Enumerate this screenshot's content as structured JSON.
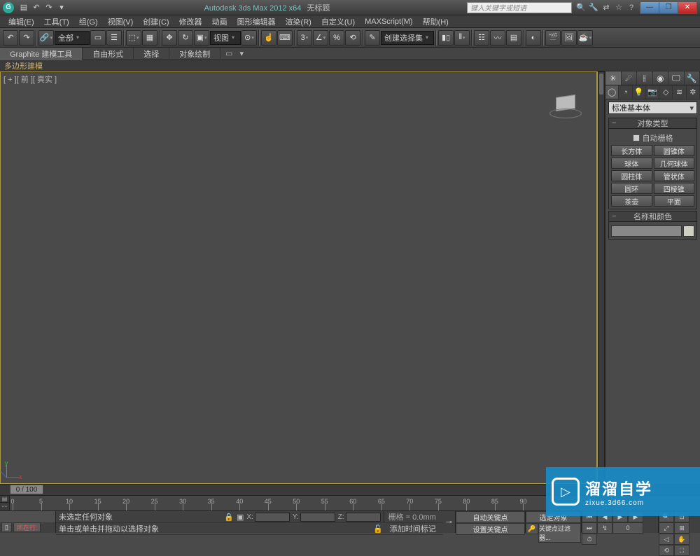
{
  "titlebar": {
    "app": "Autodesk 3ds Max  2012 x64",
    "doc": "无标题",
    "search_placeholder": "键入关键字或短语"
  },
  "menu": [
    "编辑(E)",
    "工具(T)",
    "组(G)",
    "视图(V)",
    "创建(C)",
    "修改器",
    "动画",
    "图形编辑器",
    "渲染(R)",
    "自定义(U)",
    "MAXScript(M)",
    "帮助(H)"
  ],
  "toolbar": {
    "filter": "全部",
    "viewdrop": "视图",
    "selset": "创建选择集"
  },
  "ribbon": {
    "tab": "Graphite 建模工具",
    "tabs_other": [
      "自由形式",
      "选择",
      "对象绘制"
    ],
    "panel": "多边形建模"
  },
  "viewport": {
    "label": "[ + ][ 前 ][ 真实 ]"
  },
  "cmdpanel": {
    "category": "标准基本体",
    "rollout_objtype": "对象类型",
    "autogrid": "自动栅格",
    "prims": [
      [
        "长方体",
        "圆锥体"
      ],
      [
        "球体",
        "几何球体"
      ],
      [
        "圆柱体",
        "管状体"
      ],
      [
        "圆环",
        "四棱锥"
      ],
      [
        "茶壶",
        "平面"
      ]
    ],
    "rollout_name": "名称和颜色"
  },
  "timeline": {
    "slider": "0 / 100",
    "ticks": [
      0,
      5,
      10,
      15,
      20,
      25,
      30,
      35,
      40,
      45,
      50,
      55,
      60,
      65,
      70,
      75,
      80,
      85,
      90
    ]
  },
  "status": {
    "current_line": "所在行:",
    "no_sel": "未选定任何对象",
    "prompt": "单击或单击并拖动以选择对象",
    "add_tag": "添加时间标记",
    "grid": "栅格 = 0.0mm",
    "autokey": "自动关键点",
    "setkey": "设置关键点",
    "selset": "选定对象",
    "keyfilter": "关键点过滤器..."
  },
  "coords": {
    "x": "X:",
    "y": "Y:",
    "z": "Z:"
  },
  "watermark": {
    "title": "溜溜自学",
    "url": "zixue.3d66.com"
  }
}
